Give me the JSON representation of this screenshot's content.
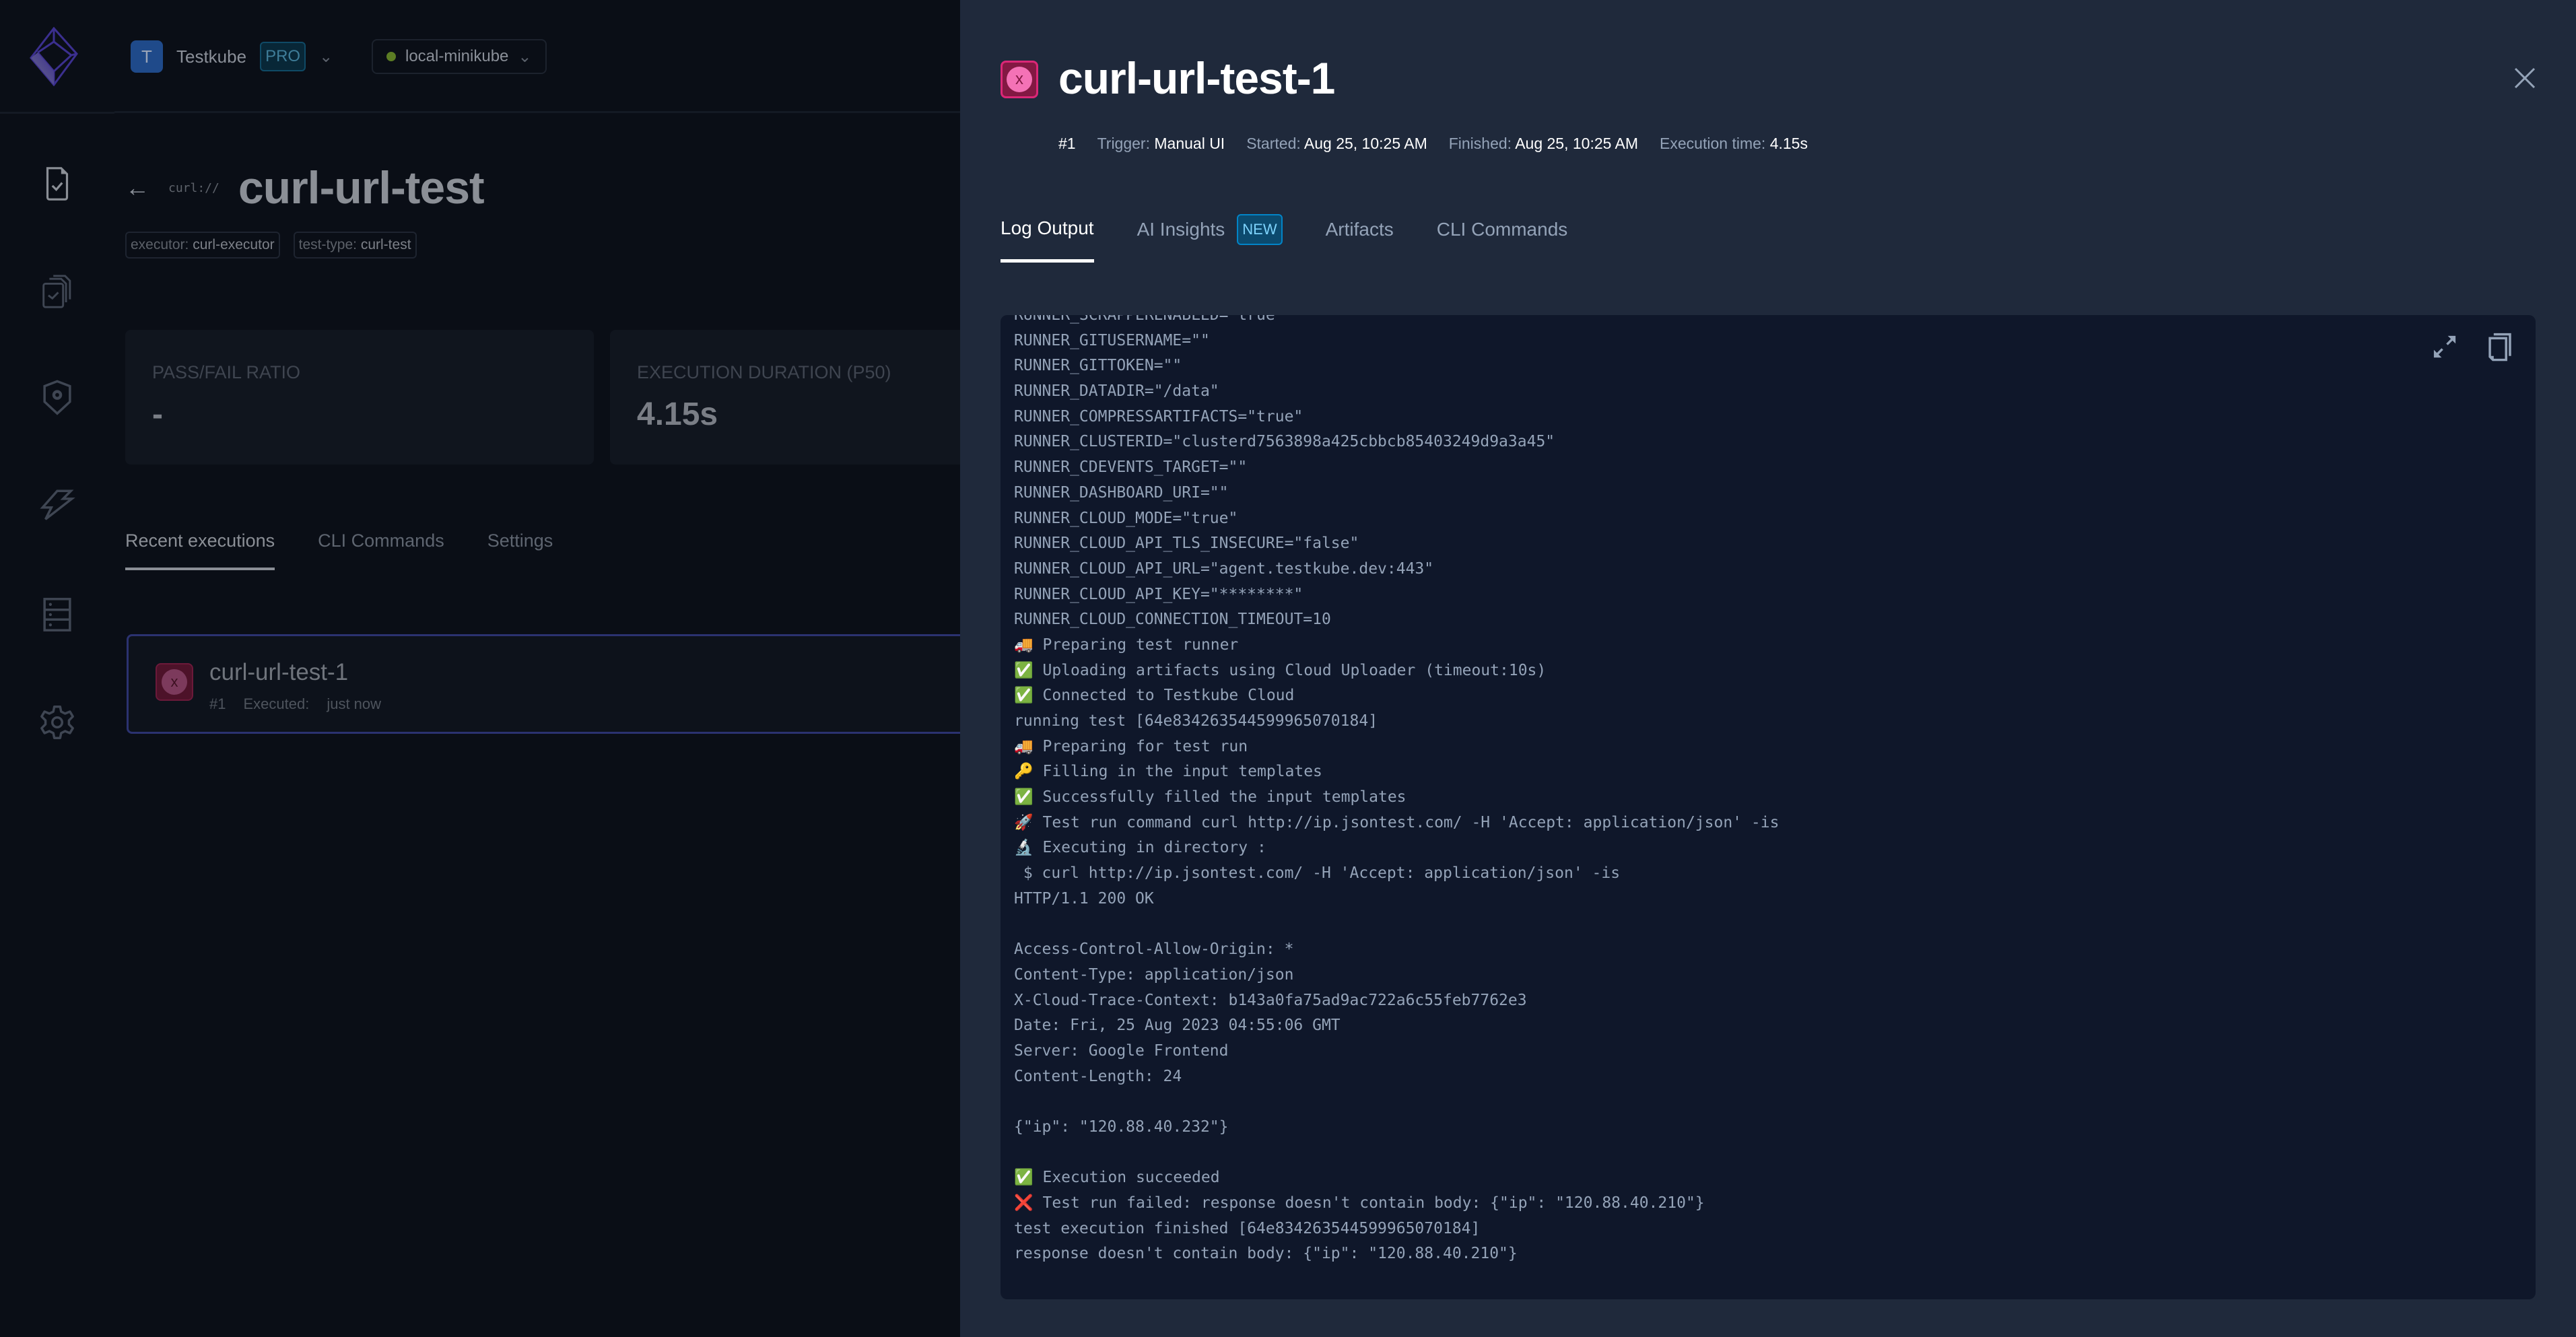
{
  "topbar": {
    "org_initial": "T",
    "org_name": "Testkube",
    "org_badge": "PRO",
    "environment": "local-minikube",
    "environment_status_color": "#5c7d24"
  },
  "sidebar": {
    "items": [
      {
        "icon": "test-file-icon",
        "label": "Tests"
      },
      {
        "icon": "test-suites-icon",
        "label": "Test Suites"
      },
      {
        "icon": "executors-icon",
        "label": "Executors"
      },
      {
        "icon": "triggers-icon",
        "label": "Triggers"
      },
      {
        "icon": "sources-icon",
        "label": "Sources"
      },
      {
        "icon": "settings-icon",
        "label": "Settings"
      }
    ]
  },
  "test": {
    "type_tag": "curl://",
    "name": "curl-url-test",
    "labels": [
      {
        "key": "executor:",
        "value": "curl-executor"
      },
      {
        "key": "test-type:",
        "value": "curl-test"
      }
    ],
    "metrics": [
      {
        "label": "PASS/FAIL RATIO",
        "value": "-"
      },
      {
        "label": "EXECUTION DURATION (P50)",
        "value": "4.15s"
      }
    ],
    "tabs": [
      {
        "label": "Recent executions",
        "active": true
      },
      {
        "label": "CLI Commands",
        "active": false
      },
      {
        "label": "Settings",
        "active": false
      }
    ],
    "executions": [
      {
        "name": "curl-url-test-1",
        "number": "#1",
        "executed_label": "Executed:",
        "executed_value": "just now",
        "status": "failed"
      }
    ]
  },
  "drawer": {
    "title": "curl-url-test-1",
    "status": "failed",
    "status_color": "#db2777",
    "meta": {
      "number": "#1",
      "trigger_label": "Trigger:",
      "trigger_value": "Manual UI",
      "started_label": "Started:",
      "started_value": "Aug 25, 10:25 AM",
      "finished_label": "Finished:",
      "finished_value": "Aug 25, 10:25 AM",
      "exec_time_label": "Execution time:",
      "exec_time_value": "4.15s"
    },
    "tabs": [
      {
        "label": "Log Output",
        "active": true
      },
      {
        "label": "AI Insights",
        "badge": "NEW",
        "active": false
      },
      {
        "label": "Artifacts",
        "active": false
      },
      {
        "label": "CLI Commands",
        "active": false
      }
    ],
    "log_lines": [
      "RUNNER_SCRAPPERENABLED=\"true\"",
      "RUNNER_GITUSERNAME=\"\"",
      "RUNNER_GITTOKEN=\"\"",
      "RUNNER_DATADIR=\"/data\"",
      "RUNNER_COMPRESSARTIFACTS=\"true\"",
      "RUNNER_CLUSTERID=\"clusterd7563898a425cbbcb85403249d9a3a45\"",
      "RUNNER_CDEVENTS_TARGET=\"\"",
      "RUNNER_DASHBOARD_URI=\"\"",
      "RUNNER_CLOUD_MODE=\"true\"",
      "RUNNER_CLOUD_API_TLS_INSECURE=\"false\"",
      "RUNNER_CLOUD_API_URL=\"agent.testkube.dev:443\"",
      "RUNNER_CLOUD_API_KEY=\"********\"",
      "RUNNER_CLOUD_CONNECTION_TIMEOUT=10",
      "🚚 Preparing test runner",
      "✅ Uploading artifacts using Cloud Uploader (timeout:10s)",
      "✅ Connected to Testkube Cloud",
      "running test [64e834263544599965070184]",
      "🚚 Preparing for test run",
      "🔑 Filling in the input templates",
      "✅ Successfully filled the input templates",
      "🚀 Test run command curl http://ip.jsontest.com/ -H 'Accept: application/json' -is",
      "🔬 Executing in directory :",
      " $ curl http://ip.jsontest.com/ -H 'Accept: application/json' -is",
      "HTTP/1.1 200 OK",
      "",
      "Access-Control-Allow-Origin: *",
      "Content-Type: application/json",
      "X-Cloud-Trace-Context: b143a0fa75ad9ac722a6c55feb7762e3",
      "Date: Fri, 25 Aug 2023 04:55:06 GMT",
      "Server: Google Frontend",
      "Content-Length: 24",
      "",
      "{\"ip\": \"120.88.40.232\"}",
      "",
      "✅ Execution succeeded",
      "❌ Test run failed: response doesn't contain body: {\"ip\": \"120.88.40.210\"}",
      "test execution finished [64e834263544599965070184]",
      "response doesn't contain body: {\"ip\": \"120.88.40.210\"}"
    ]
  }
}
